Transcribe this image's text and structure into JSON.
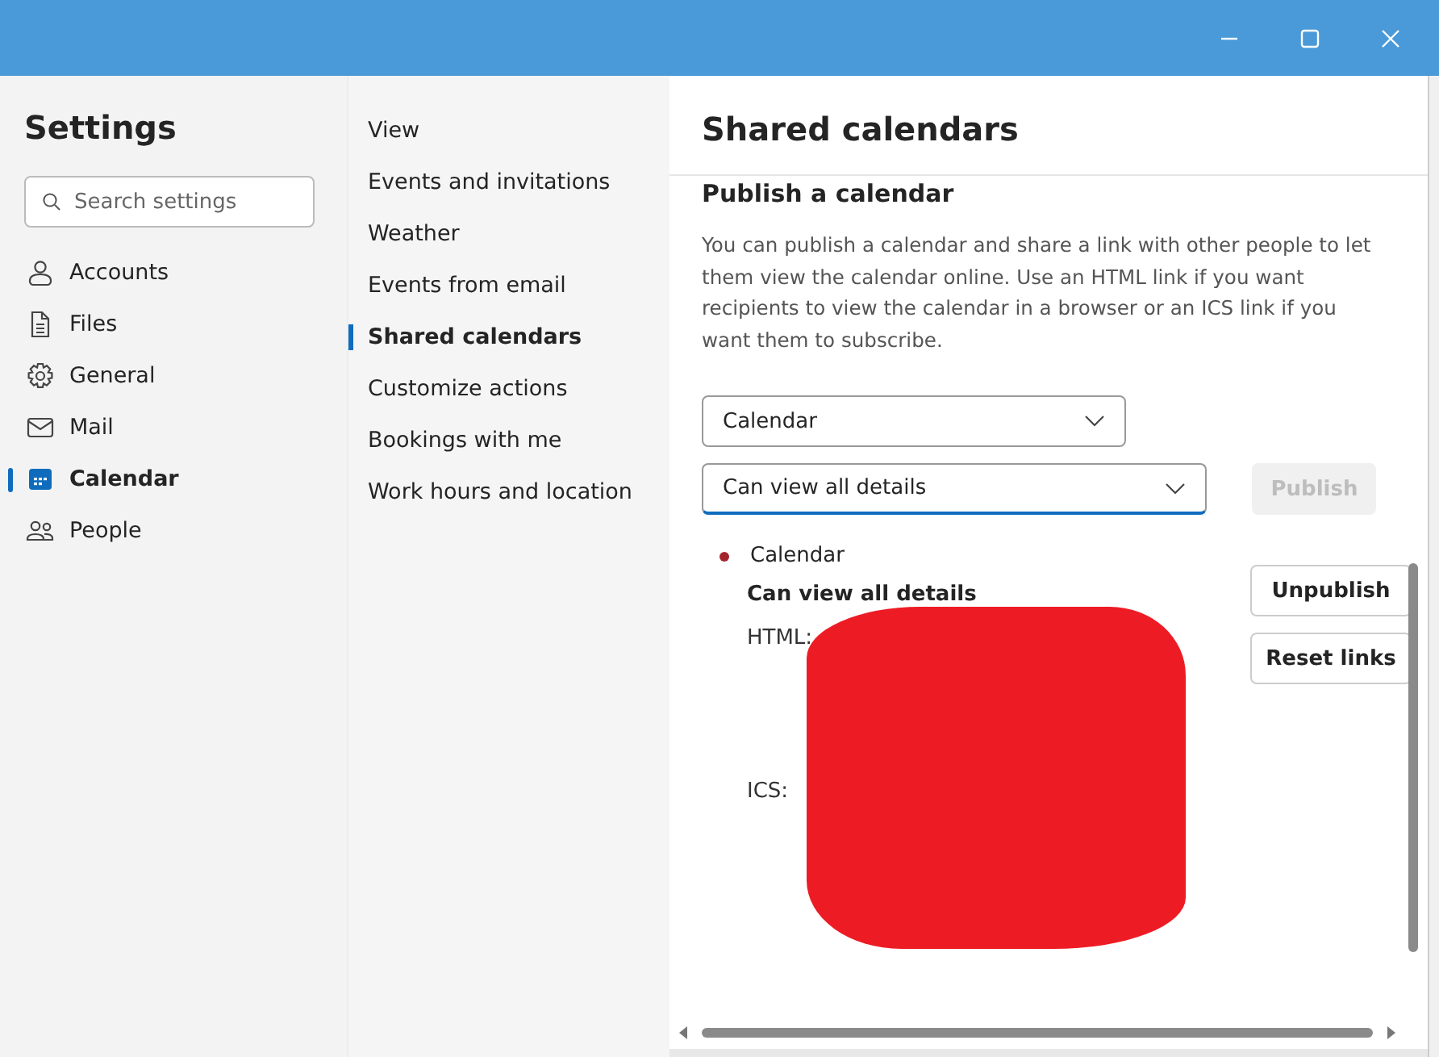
{
  "settings": {
    "title": "Settings",
    "search": {
      "placeholder": "Search settings"
    },
    "nav": [
      {
        "label": "Accounts",
        "kind": "person",
        "selected": false
      },
      {
        "label": "Files",
        "kind": "file",
        "selected": false
      },
      {
        "label": "General",
        "kind": "gear",
        "selected": false
      },
      {
        "label": "Mail",
        "kind": "mail",
        "selected": false
      },
      {
        "label": "Calendar",
        "kind": "calendar",
        "selected": true
      },
      {
        "label": "People",
        "kind": "people",
        "selected": false
      }
    ]
  },
  "subnav": [
    {
      "label": "View",
      "selected": false
    },
    {
      "label": "Events and invitations",
      "selected": false
    },
    {
      "label": "Weather",
      "selected": false
    },
    {
      "label": "Events from email",
      "selected": false
    },
    {
      "label": "Shared calendars",
      "selected": true
    },
    {
      "label": "Customize actions",
      "selected": false
    },
    {
      "label": "Bookings with me",
      "selected": false
    },
    {
      "label": "Work hours and location",
      "selected": false
    }
  ],
  "panel": {
    "title": "Shared calendars",
    "section_title": "Publish a calendar",
    "description": "You can publish a calendar and share a link with other people to let them view the calendar online. Use an HTML link if you want recipients to view the calendar in a browser or an ICS link if you want them to subscribe.",
    "calendar_select": {
      "value": "Calendar",
      "focused": false
    },
    "permission_select": {
      "value": "Can view all details",
      "focused": true
    },
    "publish_button": {
      "label": "Publish",
      "disabled": true
    },
    "published": {
      "name": "Calendar",
      "color": "#a4262c",
      "permission": "Can view all details",
      "link_labels": [
        "HTML:",
        "ICS:"
      ],
      "buttons": [
        "Unpublish",
        "Reset links"
      ]
    }
  }
}
